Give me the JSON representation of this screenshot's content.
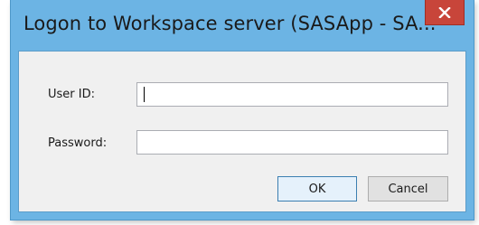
{
  "window": {
    "title": "Logon to Workspace server (SASApp - SA...",
    "close_icon": "close-icon"
  },
  "form": {
    "user_id_label": "User ID:",
    "user_id_value": "",
    "password_label": "Password:",
    "password_value": ""
  },
  "buttons": {
    "ok_label": "OK",
    "cancel_label": "Cancel"
  },
  "colors": {
    "title_bar": "#6cb4e4",
    "close_button": "#c8453a",
    "client_bg": "#f0f0f0",
    "ok_button_bg": "#e5f1fb",
    "ok_button_border": "#3c7fb1"
  }
}
